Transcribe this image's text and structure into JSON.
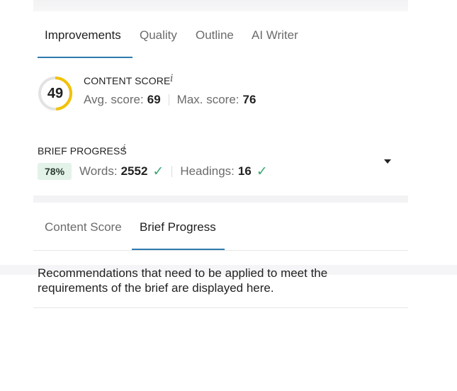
{
  "tabs": [
    {
      "label": "Improvements",
      "active": true
    },
    {
      "label": "Quality",
      "active": false
    },
    {
      "label": "Outline",
      "active": false
    },
    {
      "label": "AI Writer",
      "active": false
    }
  ],
  "content_score": {
    "title": "CONTENT SCORE",
    "info_icon": "i",
    "score": "49",
    "score_value": 49,
    "score_max": 100,
    "avg_label": "Avg. score:",
    "avg_value": "69",
    "max_label": "Max. score:",
    "max_value": "76",
    "ring_color": "#f2c200",
    "ring_track_color": "#e3e3e3"
  },
  "brief_progress": {
    "title": "BRIEF PROGRESS",
    "info_icon": "i",
    "percent": "78%",
    "words_label": "Words:",
    "words_value": "2552",
    "headings_label": "Headings:",
    "headings_value": "16",
    "check_icon": "✓",
    "check_color": "#3aa772"
  },
  "sub_tabs": [
    {
      "label": "Content Score",
      "active": false
    },
    {
      "label": "Brief Progress",
      "active": true
    }
  ],
  "description": "Recommendations that need to be applied to meet the requirements of the brief are displayed here.",
  "colors": {
    "accent": "#2f7ab0",
    "badge_bg": "#e3f3ea"
  }
}
